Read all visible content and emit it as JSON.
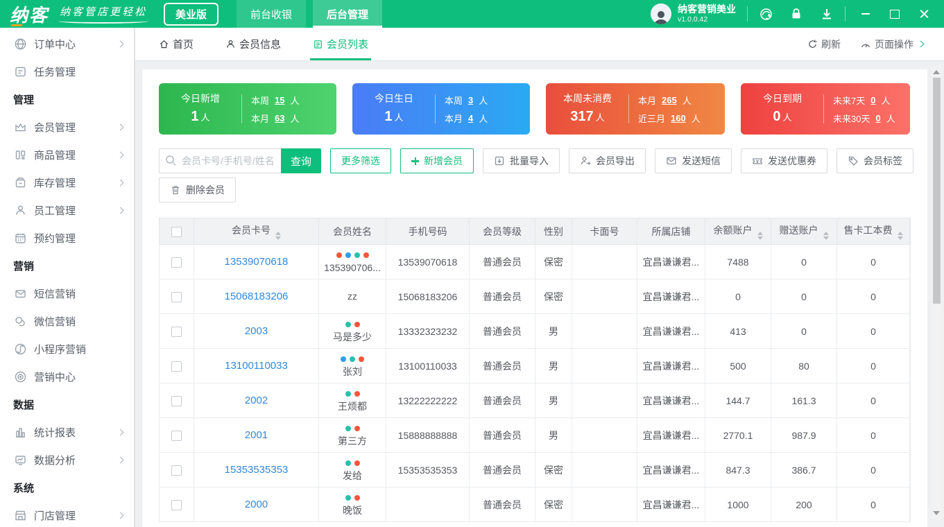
{
  "topbar": {
    "logo": "纳客",
    "slogan": "纳客管店更轻松",
    "edition": "美业版",
    "nav_front": "前台收银",
    "nav_back": "后台管理",
    "user_name": "纳客营销美业",
    "user_version": "v1.0.0.42"
  },
  "sidebar": {
    "items": [
      {
        "label": "订单中心",
        "icon": "orders-icon",
        "arrow": true
      },
      {
        "label": "任务管理",
        "icon": "tasks-icon",
        "arrow": false
      },
      {
        "label": "管理",
        "section": true
      },
      {
        "label": "会员管理",
        "icon": "members-icon",
        "arrow": true
      },
      {
        "label": "商品管理",
        "icon": "goods-icon",
        "arrow": true
      },
      {
        "label": "库存管理",
        "icon": "inventory-icon",
        "arrow": true
      },
      {
        "label": "员工管理",
        "icon": "staff-icon",
        "arrow": true
      },
      {
        "label": "预约管理",
        "icon": "appointment-icon",
        "arrow": false
      },
      {
        "label": "营销",
        "section": true
      },
      {
        "label": "短信营销",
        "icon": "sms-icon",
        "arrow": false
      },
      {
        "label": "微信营销",
        "icon": "wechat-icon",
        "arrow": false
      },
      {
        "label": "小程序营销",
        "icon": "miniapp-icon",
        "arrow": false
      },
      {
        "label": "营销中心",
        "icon": "marketing-icon",
        "arrow": false
      },
      {
        "label": "数据",
        "section": true
      },
      {
        "label": "统计报表",
        "icon": "report-icon",
        "arrow": true
      },
      {
        "label": "数据分析",
        "icon": "analysis-icon",
        "arrow": true
      },
      {
        "label": "系统",
        "section": true
      },
      {
        "label": "门店管理",
        "icon": "store-icon",
        "arrow": true
      }
    ]
  },
  "tabbar": {
    "tabs": [
      {
        "label": "首页",
        "icon": "home-icon"
      },
      {
        "label": "会员信息",
        "icon": "person-icon"
      },
      {
        "label": "会员列表",
        "icon": "list-icon",
        "active": true
      }
    ],
    "refresh": "刷新",
    "page_ops": "页面操作"
  },
  "stats": [
    {
      "title": "今日新增",
      "value": "1",
      "unit": "人",
      "gradient": [
        "#2db64e",
        "#4ed36f"
      ],
      "lines": [
        {
          "label": "本周",
          "value": "15",
          "unit": "人"
        },
        {
          "label": "本月",
          "value": "63",
          "unit": "人"
        }
      ]
    },
    {
      "title": "今日生日",
      "value": "1",
      "unit": "人",
      "gradient": [
        "#4a7cf6",
        "#2aaaf2"
      ],
      "lines": [
        {
          "label": "本周",
          "value": "3",
          "unit": "人"
        },
        {
          "label": "本月",
          "value": "4",
          "unit": "人"
        }
      ]
    },
    {
      "title": "本周未消费",
      "value": "317",
      "unit": "人",
      "gradient": [
        "#e94e3c",
        "#f08843"
      ],
      "lines": [
        {
          "label": "本月",
          "value": "265",
          "unit": "人"
        },
        {
          "label": "近三月",
          "value": "160",
          "unit": "人"
        }
      ]
    },
    {
      "title": "今日到期",
      "value": "0",
      "unit": "人",
      "gradient": [
        "#ee423f",
        "#fb7169"
      ],
      "lines": [
        {
          "label": "未来7天",
          "value": "0",
          "unit": "人"
        },
        {
          "label": "未来30天",
          "value": "0",
          "unit": "人"
        }
      ]
    }
  ],
  "toolbar": {
    "search_placeholder": "会员卡号/手机号/姓名",
    "search": "查询",
    "more_filters": "更多筛选",
    "add_member": "新增会员",
    "batch_import": "批量导入",
    "member_export": "会员导出",
    "send_sms": "发送短信",
    "send_coupon": "发送优惠券",
    "member_tag": "会员标签",
    "delete_member": "删除会员"
  },
  "table": {
    "headers": {
      "card": "会员卡号",
      "name": "会员姓名",
      "phone": "手机号码",
      "level": "会员等级",
      "gender": "性别",
      "face": "卡面号",
      "store": "所属店铺",
      "balance": "余额账户",
      "gift": "赠送账户",
      "fee": "售卡工本费"
    },
    "sortable_columns": [
      "会员卡号",
      "余额账户",
      "赠送账户",
      "售卡工本费"
    ],
    "rows": [
      {
        "card": "13539070618",
        "tags": [
          "red",
          "blue",
          "teal",
          "red"
        ],
        "name": "135390706...",
        "phone": "13539070618",
        "level": "普通会员",
        "gender": "保密",
        "face": "",
        "store": "宜昌谦谦君...",
        "balance": "7488",
        "gift": "0",
        "fee": "0"
      },
      {
        "card": "15068183206",
        "tags": [],
        "name": "zz",
        "phone": "15068183206",
        "level": "普通会员",
        "gender": "保密",
        "face": "",
        "store": "宜昌谦谦君...",
        "balance": "0",
        "gift": "0",
        "fee": "0"
      },
      {
        "card": "2003",
        "tags": [
          "teal",
          "red"
        ],
        "name": "马是多少",
        "phone": "13332323232",
        "level": "普通会员",
        "gender": "男",
        "face": "",
        "store": "宜昌谦谦君...",
        "balance": "413",
        "gift": "0",
        "fee": "0"
      },
      {
        "card": "13100110033",
        "tags": [
          "blue",
          "teal",
          "red"
        ],
        "name": "张刘",
        "phone": "13100110033",
        "level": "普通会员",
        "gender": "男",
        "face": "",
        "store": "宜昌谦谦君...",
        "balance": "500",
        "gift": "80",
        "fee": "0"
      },
      {
        "card": "2002",
        "tags": [
          "teal",
          "red"
        ],
        "name": "王烦都",
        "phone": "13222222222",
        "level": "普通会员",
        "gender": "男",
        "face": "",
        "store": "宜昌谦谦君...",
        "balance": "144.7",
        "gift": "161.3",
        "fee": "0"
      },
      {
        "card": "2001",
        "tags": [
          "teal",
          "red"
        ],
        "name": "第三方",
        "phone": "15888888888",
        "level": "普通会员",
        "gender": "男",
        "face": "",
        "store": "宜昌谦谦君...",
        "balance": "2770.1",
        "gift": "987.9",
        "fee": "0"
      },
      {
        "card": "15353535353",
        "tags": [
          "teal",
          "red"
        ],
        "name": "发给",
        "phone": "15353535353",
        "level": "普通会员",
        "gender": "保密",
        "face": "",
        "store": "宜昌谦谦君...",
        "balance": "847.3",
        "gift": "386.7",
        "fee": "0"
      },
      {
        "card": "2000",
        "tags": [
          "teal",
          "red"
        ],
        "name": "晚饭",
        "phone": "",
        "level": "普通会员",
        "gender": "保密",
        "face": "",
        "store": "宜昌谦谦君...",
        "balance": "1000",
        "gift": "200",
        "fee": "0"
      }
    ]
  },
  "icons": {
    "topbar": [
      "customer-service-icon",
      "lock-icon",
      "download-icon",
      "minimize-icon",
      "maximize-icon",
      "close-icon"
    ],
    "toolbar": [
      "search-icon",
      "plus-icon",
      "import-icon",
      "export-icon",
      "envelope-icon",
      "coupon-icon",
      "tag-icon",
      "trash-icon"
    ],
    "tag_dot_colors": {
      "red": "#f4573a",
      "blue": "#2d9fe8",
      "teal": "#27c2af"
    }
  },
  "colors": {
    "brand_green": "#0ebe7c",
    "link_blue": "#3089dc",
    "stat_green": [
      "#2db64e",
      "#4ed36f"
    ],
    "stat_blue": [
      "#4a7cf6",
      "#2aaaf2"
    ],
    "stat_orange": [
      "#e94e3c",
      "#f08843"
    ],
    "stat_red": [
      "#ee423f",
      "#fb7169"
    ]
  }
}
